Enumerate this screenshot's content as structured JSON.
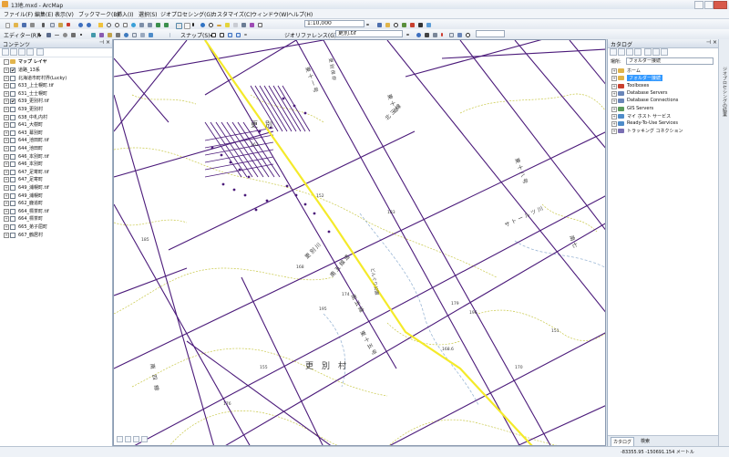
{
  "window": {
    "title": "13地.mxd - ArcMap"
  },
  "menubar": {
    "items": [
      "ファイル(F)",
      "編集(E)",
      "表示(V)",
      "ブックマーク(B)",
      "挿入(I)",
      "選択(S)",
      "ジオプロセシング(G)",
      "カスタマイズ(C)",
      "ウィンドウ(W)",
      "ヘルプ(H)"
    ]
  },
  "toolbar": {
    "scale": "1:10,000",
    "editor_label": "エディター(R)▾",
    "snap_label": "スナップ(S)▾",
    "georef_label": "ジオリファレンス(G)▾",
    "georef_layer": "更別.tif"
  },
  "toc": {
    "title": "コンテンツ",
    "root_label": "マップ レイヤ",
    "layers": [
      {
        "label": "道路_13系",
        "checked": true
      },
      {
        "label": "北海道市町村界(Lucky)",
        "checked": false
      },
      {
        "label": "633_上士幌町.tif",
        "checked": false
      },
      {
        "label": "631_士士幌町",
        "checked": false
      },
      {
        "label": "639_更別村.tif",
        "checked": true
      },
      {
        "label": "639_更別村",
        "checked": false
      },
      {
        "label": "638_中札内村",
        "checked": false
      },
      {
        "label": "641_大樹町",
        "checked": false
      },
      {
        "label": "643_幕別町",
        "checked": false
      },
      {
        "label": "644_池田町.tif",
        "checked": false
      },
      {
        "label": "644_池田町",
        "checked": false
      },
      {
        "label": "646_本別町.tif",
        "checked": false
      },
      {
        "label": "646_本別町",
        "checked": false
      },
      {
        "label": "647_足寄町.tif",
        "checked": false
      },
      {
        "label": "647_足寄町",
        "checked": false
      },
      {
        "label": "649_浦幌町.tif",
        "checked": false
      },
      {
        "label": "649_浦幌町",
        "checked": false
      },
      {
        "label": "662_鹿追町",
        "checked": false
      },
      {
        "label": "664_標茶町.tif",
        "checked": false
      },
      {
        "label": "664_標茶町",
        "checked": false
      },
      {
        "label": "665_弟子屈町",
        "checked": false
      },
      {
        "label": "667_鶴居村",
        "checked": false
      }
    ]
  },
  "catalog": {
    "title": "カタログ",
    "location_label": "場所:",
    "location_value": "フォルダー接続",
    "items": [
      {
        "label": "ホーム",
        "icon": "folder-icon",
        "color": "#e0b44a"
      },
      {
        "label": "フォルダー接続",
        "icon": "folder-connection-icon",
        "color": "#e0b44a",
        "selected": true
      },
      {
        "label": "Toolboxes",
        "icon": "toolbox-icon",
        "color": "#c8402f"
      },
      {
        "label": "Database Servers",
        "icon": "database-server-icon",
        "color": "#6a86b8"
      },
      {
        "label": "Database Connections",
        "icon": "database-connection-icon",
        "color": "#6a86b8"
      },
      {
        "label": "GIS Servers",
        "icon": "gis-server-icon",
        "color": "#5b9b5b"
      },
      {
        "label": "マイ ホスト サービス",
        "icon": "hosted-services-icon",
        "color": "#4f8cc9"
      },
      {
        "label": "Ready-To-Use Services",
        "icon": "ready-services-icon",
        "color": "#4f8cc9"
      },
      {
        "label": "トラッキング コネクション",
        "icon": "tracking-icon",
        "color": "#7a6fb3"
      }
    ],
    "bottom_tabs": [
      "カタログ",
      "検索"
    ]
  },
  "side_tab": {
    "label": "ジオプロセシングの結果"
  },
  "map": {
    "labels": {
      "village_name": "更　別　村",
      "district_label": "更　別",
      "south_area": "南　四　線",
      "north_area": "北 三 線",
      "river_label": "更 別 川",
      "route_label": "南 五 線 道",
      "vertical_label": "どんぐり公園",
      "top_label": "東 十 一 号",
      "top_label2": "更 別 保 存",
      "east_label": "東 十 八 号",
      "east_label2": "サ ト ー ル ツ 川",
      "se_label": "東 十 五 号",
      "mid_label": "南 五 線",
      "s_label": "東 十 号",
      "river2": "南 七"
    },
    "elevations": [
      "162",
      "152",
      "185",
      "183",
      "179",
      "174",
      "196",
      "155",
      "195",
      "168.6",
      "151",
      "170",
      "168",
      "176"
    ],
    "colors": {
      "road": "#4b1a7a",
      "highway": "#f4ea2a",
      "contour": "#c9c94a",
      "stream": "#9bb7d6",
      "text": "#3a3a3a"
    }
  },
  "status": {
    "coordinates": "-83355.95  -150691.154 メートル"
  }
}
